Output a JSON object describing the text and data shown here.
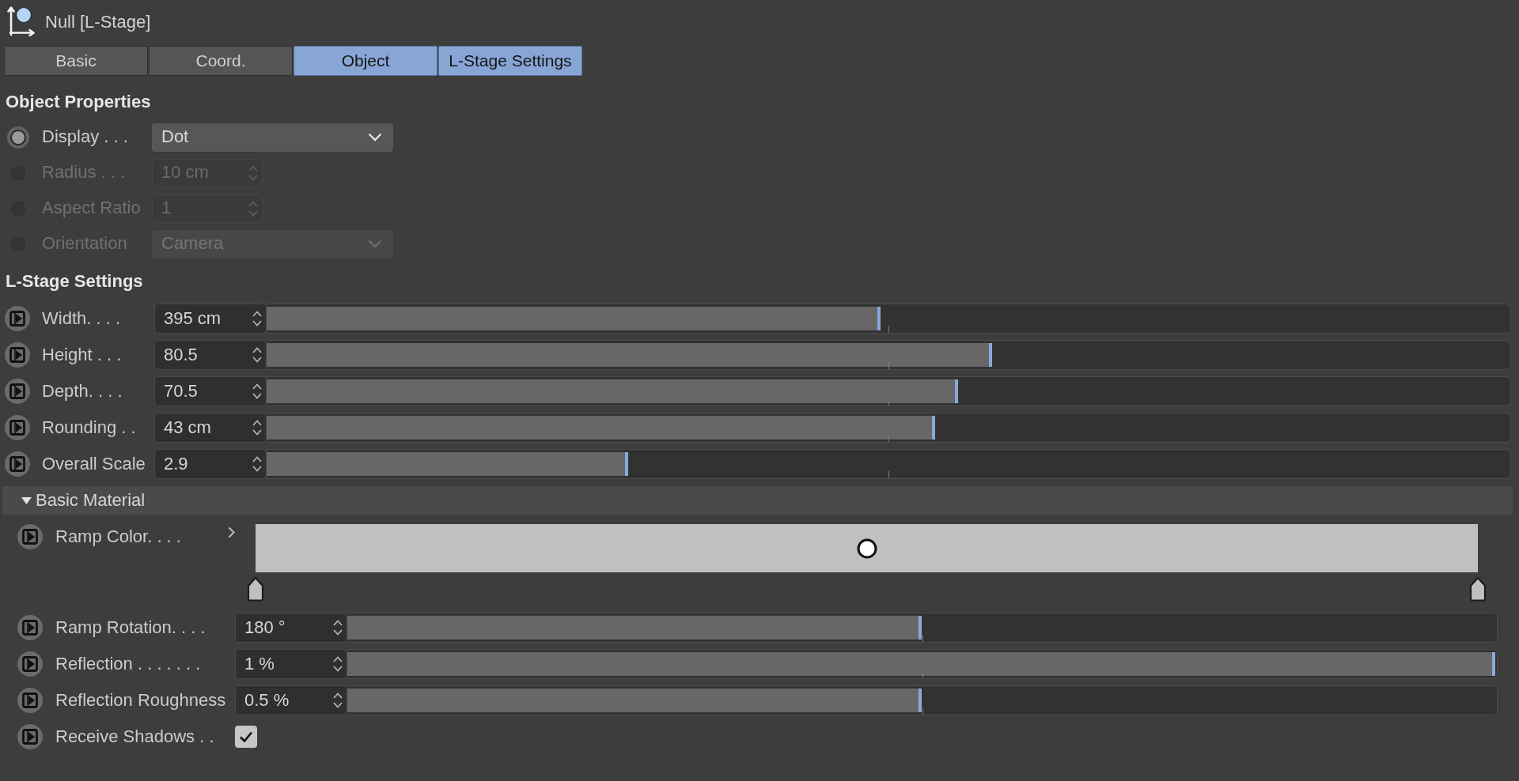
{
  "header": {
    "title": "Null [L-Stage]"
  },
  "tabs": [
    {
      "label": "Basic",
      "selected": false
    },
    {
      "label": "Coord.",
      "selected": false
    },
    {
      "label": "Object",
      "selected": true
    },
    {
      "label": "L-Stage Settings",
      "selected": true
    }
  ],
  "sections": [
    {
      "kind": "heading",
      "title": "Object Properties",
      "rows": [
        {
          "kind": "dropdown",
          "label": "Display . . .",
          "value": "Dot",
          "disabled": false
        },
        {
          "kind": "number",
          "label": "Radius . . .",
          "value": "10 cm",
          "disabled": true
        },
        {
          "kind": "number",
          "label": "Aspect Ratio",
          "value": "1",
          "disabled": true
        },
        {
          "kind": "dropdown",
          "label": "Orientation",
          "value": "Camera",
          "disabled": true
        }
      ]
    },
    {
      "kind": "heading",
      "title": "L-Stage Settings",
      "rows": [
        {
          "kind": "slider",
          "label": "Width. . . .",
          "value": "395 cm",
          "level": 0.494
        },
        {
          "kind": "slider",
          "label": "Height . . .",
          "value": "80.5",
          "level": 0.584
        },
        {
          "kind": "slider",
          "label": "Depth. . . .",
          "value": "70.5",
          "level": 0.557
        },
        {
          "kind": "slider",
          "label": "Rounding . .",
          "value": "43 cm",
          "level": 0.538
        },
        {
          "kind": "slider",
          "label": "Overall Scale",
          "value": "2.9",
          "level": 0.291
        }
      ]
    },
    {
      "kind": "group",
      "title": "Basic Material",
      "expanded": true,
      "rows": [
        {
          "kind": "ramp",
          "label": "Ramp Color. . . .",
          "expanded": false,
          "knots": [
            {
              "color": "#c0c0c0"
            },
            {
              "color": "#c0c0c0"
            }
          ]
        },
        {
          "kind": "slider",
          "label": "Ramp Rotation. . . .",
          "value": "180 °",
          "level": 0.5
        },
        {
          "kind": "slider",
          "label": "Reflection . . . . . . .",
          "value": "1 %",
          "level": 1
        },
        {
          "kind": "slider",
          "label": "Reflection Roughness",
          "value": "0.5 %",
          "level": 0.5
        },
        {
          "kind": "checkbox",
          "label": "Receive Shadows . .",
          "checked": true
        }
      ]
    }
  ]
}
